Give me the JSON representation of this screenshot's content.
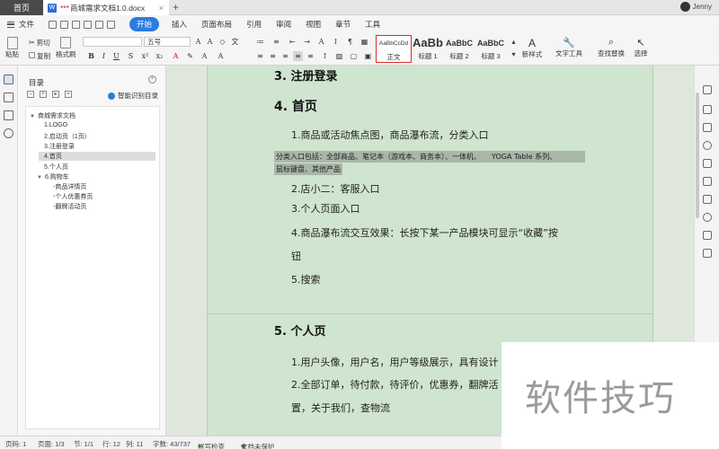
{
  "titlebar": {
    "home_tab": "首页",
    "doc_tab_icon": "W",
    "doc_tab_prefix": "***",
    "doc_tab_title": "商城需求文档1.0.docx",
    "close": "×",
    "add": "+",
    "user": "Jenny"
  },
  "menu": {
    "file": "文件",
    "start": "开始",
    "insert": "插入",
    "layout": "页面布局",
    "references": "引用",
    "review": "审阅",
    "view": "视图",
    "chapter": "章节",
    "tools": "工具"
  },
  "ribbon": {
    "paste": "粘贴",
    "cut": "剪切",
    "copy": "复制",
    "format_painter": "格式刷",
    "font_name": "",
    "font_size": "五号",
    "bold": "B",
    "italic": "I",
    "underline": "U",
    "styles": [
      {
        "sample": "AaBbCcDd",
        "label": "正文"
      },
      {
        "sample": "AaBb",
        "label": "标题 1"
      },
      {
        "sample": "AaBbC",
        "label": "标题 2"
      },
      {
        "sample": "AaBbC",
        "label": "标题 3"
      }
    ],
    "new_style": "新样式",
    "text_tools": "文字工具",
    "find_replace": "查找替换",
    "select": "选择"
  },
  "outline": {
    "title": "目录",
    "smart": "智能识别目录",
    "items": [
      {
        "label": "商城需求文档"
      },
      {
        "label": "1.LOGO"
      },
      {
        "label": "2.启动页（1页）"
      },
      {
        "label": "3.注册登录"
      },
      {
        "label": "4.首页"
      },
      {
        "label": "5.个人页"
      },
      {
        "label": "6.购物车"
      },
      {
        "label": "-商品详情页"
      },
      {
        "label": "-个人优惠券页"
      },
      {
        "label": "-翻牌活动页"
      }
    ]
  },
  "doc": {
    "h3": "3.  注册登录",
    "h4": "4.  首页",
    "p1": "1.商品或活动焦点图，商品瀑布流，分类入口",
    "hl1": "分类入口包括：全部商品、笔记本（游戏本、商务本）、一体机、　　YOGA Table 系列、",
    "hl2": "鼠标键盘、其他产品",
    "p2": "2.店小二：客服入口",
    "p3": "3.个人页面入口",
    "p4": "4.商品瀑布流交互效果：长按下某一产品模块可显示“收藏”按",
    "p4b": "钮",
    "p5": "5.搜索",
    "h5": "5.  个人页",
    "q1": "1.用户头像，用户名，用户等级展示，具有设计",
    "q2": "2.全部订单，待付款，待评价，优惠券，翻牌活",
    "q3": "置，关于我们，查物流"
  },
  "status": {
    "page_num": "页码: 1",
    "pages": "页面: 1/3",
    "section": "节: 1/1",
    "row": "行: 12",
    "col": "列: 11",
    "words": "字数: 43/737",
    "spell": "拼写检查",
    "protect": "文档未保护"
  },
  "watermark": "软件技巧"
}
